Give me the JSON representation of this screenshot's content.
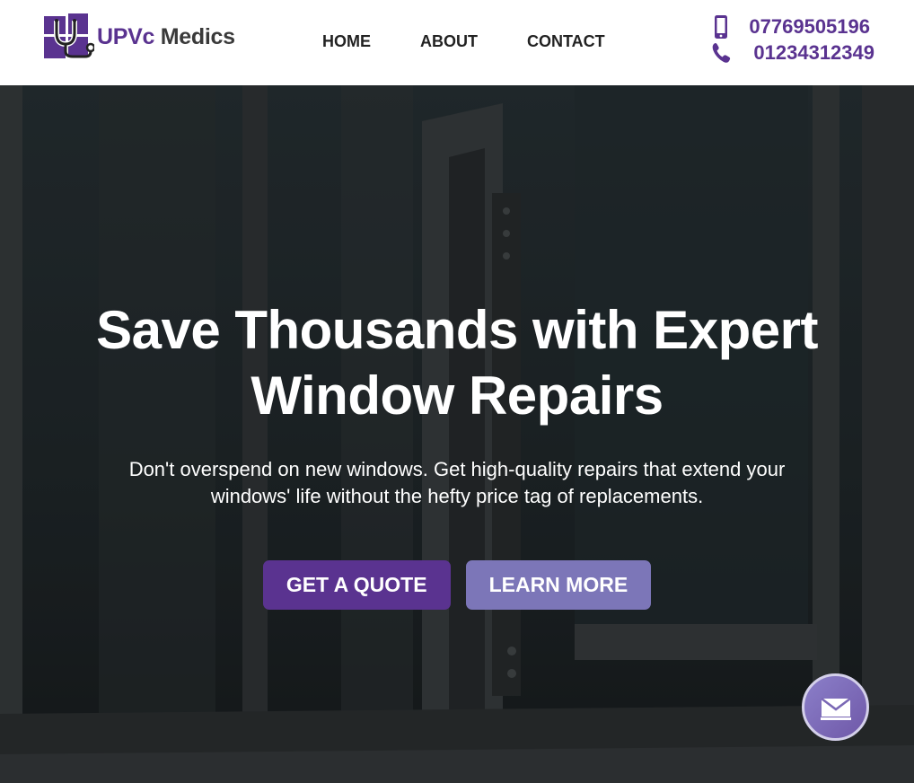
{
  "brand": {
    "name_part1": "UPVc",
    "name_part2": "Medics",
    "logo_icon": "window-stethoscope-icon",
    "primary_color": "#5a3390",
    "secondary_color": "#7c76b8"
  },
  "nav": {
    "items": [
      {
        "label": "HOME"
      },
      {
        "label": "ABOUT"
      },
      {
        "label": "CONTACT"
      }
    ]
  },
  "contact": {
    "mobile": {
      "icon": "mobile-phone-icon",
      "number": "07769505196"
    },
    "landline": {
      "icon": "phone-handset-icon",
      "number": "01234312349"
    }
  },
  "hero": {
    "title_line1": "Save Thousands with Expert",
    "title_line2": "Window Repairs",
    "subtitle_line1": "Don't overspend on new windows. Get high-quality repairs that extend your",
    "subtitle_line2": "windows' life without the hefty price tag of replacements.",
    "primary_button": "GET A QUOTE",
    "secondary_button": "LEARN MORE"
  },
  "floating": {
    "icon": "envelope-icon"
  }
}
